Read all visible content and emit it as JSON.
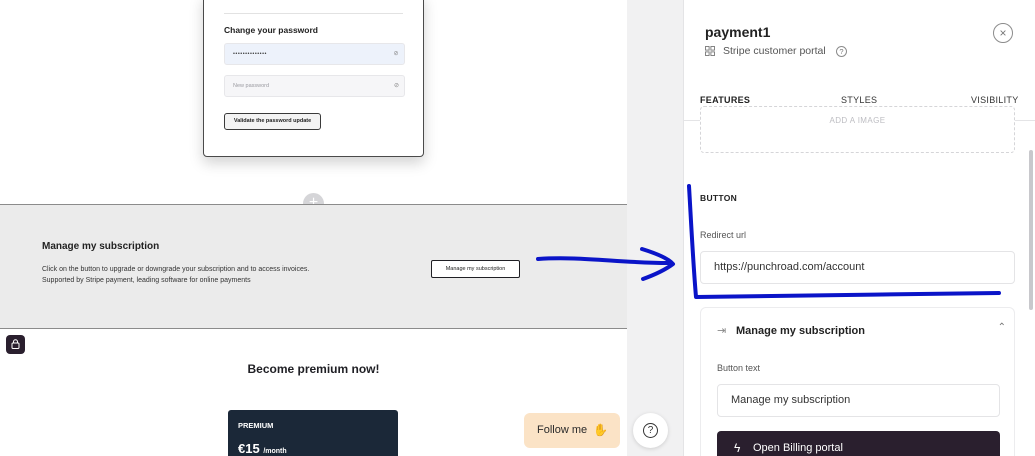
{
  "canvas": {
    "password_card": {
      "title": "Change your password",
      "current_value": "••••••••••••••",
      "new_placeholder": "New password",
      "validate_label": "Validate the password update",
      "eye_icon": "eye-off-icon"
    },
    "subscription_section": {
      "title": "Manage my subscription",
      "description_line1": "Click on the button to upgrade or downgrade your subscription and to access invoices.",
      "description_line2": "Supported by Stripe payment, leading software for online payments",
      "button_label": "Manage my subscription"
    },
    "premium": {
      "title": "Become premium now!",
      "card_label": "PREMIUM",
      "price": "€15",
      "unit": "/month"
    },
    "follow_label": "Follow me",
    "follow_icon": "waving-hand-icon",
    "help_icon": "?"
  },
  "panel": {
    "title": "payment1",
    "subtitle": "Stripe customer portal",
    "info_icon": "?",
    "close_icon": "×",
    "tabs": [
      {
        "label": "FEATURES"
      },
      {
        "label": "STYLES"
      },
      {
        "label": "VISIBILITY"
      }
    ],
    "image_box_label": "ADD A IMAGE",
    "button_section": {
      "label": "BUTTON",
      "redirect_label": "Redirect url",
      "redirect_value": "https://punchroad.com/account"
    },
    "subscription_card": {
      "title": "Manage my subscription",
      "button_text_label": "Button text",
      "button_text_value": "Manage my subscription",
      "billing_label": "Open Billing portal"
    }
  },
  "colors": {
    "accent_tab": "#f08a1d",
    "dark_button": "#2a1f2e",
    "annotation": "#0a14c8",
    "follow_bg": "#fbe3c6",
    "premium_card": "#1b2838"
  }
}
